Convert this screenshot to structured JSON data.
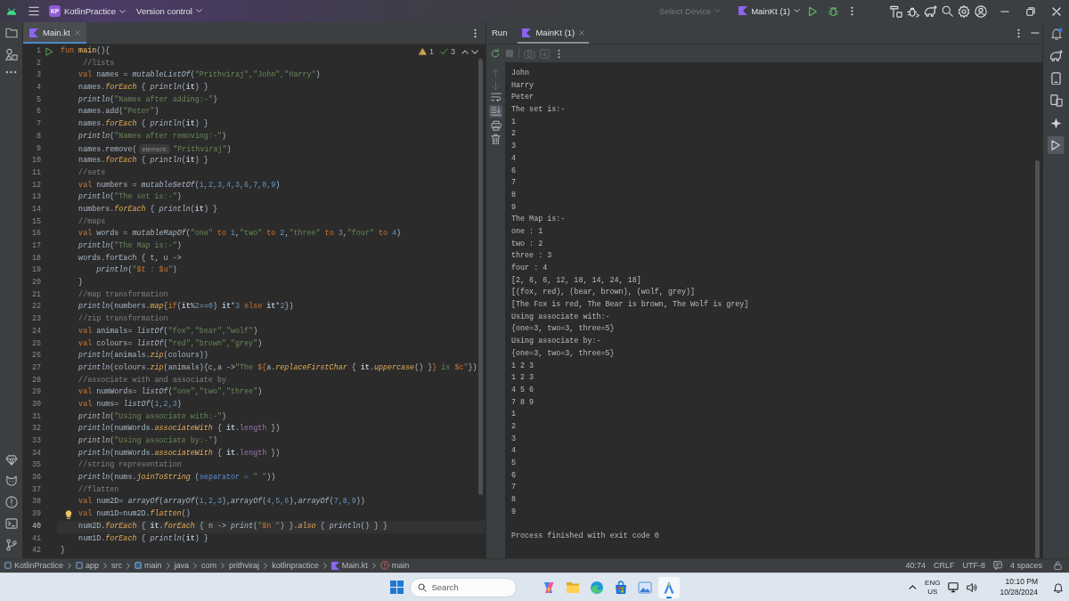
{
  "title_bar": {
    "project_badge": "KP",
    "project": "KotlinPractice",
    "vcs": "Version control",
    "device": {
      "label": "Select Device",
      "disabled": true
    },
    "run_config": "MainKt (1)"
  },
  "editor": {
    "tabs": [
      {
        "label": "Main.kt",
        "selected": true
      }
    ],
    "warnings": "1",
    "checks": "3",
    "lines": [
      {
        "number": "1",
        "kind": "run",
        "current": false,
        "tokens": [
          {
            "kind": "kw",
            "text": "fun "
          },
          {
            "kind": "decl",
            "text": "main"
          },
          {
            "kind": "txt",
            "text": "(){"
          }
        ]
      },
      {
        "number": "2",
        "kind": "plain",
        "current": false,
        "tokens": [
          {
            "kind": "cmt",
            "text": "     //lists"
          }
        ]
      },
      {
        "number": "3",
        "kind": "plain",
        "current": false,
        "tokens": [
          {
            "kind": "kw",
            "text": "    val "
          },
          {
            "kind": "txt",
            "text": "names = "
          },
          {
            "kind": "call",
            "text": "mutableListOf"
          },
          {
            "kind": "txt",
            "text": "("
          },
          {
            "kind": "str",
            "text": "\"Prithviraj\",\"John\",\"Harry\""
          },
          {
            "kind": "txt",
            "text": ")"
          }
        ]
      },
      {
        "number": "4",
        "kind": "plain",
        "current": false,
        "tokens": [
          {
            "kind": "txt",
            "text": "    names."
          },
          {
            "kind": "ext",
            "text": "forEach"
          },
          {
            "kind": "txt",
            "text": " { "
          },
          {
            "kind": "call",
            "text": "println"
          },
          {
            "kind": "txt",
            "text": "("
          },
          {
            "kind": "it",
            "text": "it"
          },
          {
            "kind": "txt",
            "text": ") }"
          }
        ]
      },
      {
        "number": "5",
        "kind": "plain",
        "current": false,
        "tokens": [
          {
            "kind": "call",
            "text": "    println"
          },
          {
            "kind": "txt",
            "text": "("
          },
          {
            "kind": "str",
            "text": "\"Names after adding:-\""
          },
          {
            "kind": "txt",
            "text": ")"
          }
        ]
      },
      {
        "number": "6",
        "kind": "plain",
        "current": false,
        "tokens": [
          {
            "kind": "txt",
            "text": "    names.add("
          },
          {
            "kind": "str",
            "text": "\"Peter\""
          },
          {
            "kind": "txt",
            "text": ")"
          }
        ]
      },
      {
        "number": "7",
        "kind": "plain",
        "current": false,
        "tokens": [
          {
            "kind": "txt",
            "text": "    names."
          },
          {
            "kind": "ext",
            "text": "forEach"
          },
          {
            "kind": "txt",
            "text": " { "
          },
          {
            "kind": "call",
            "text": "println"
          },
          {
            "kind": "txt",
            "text": "("
          },
          {
            "kind": "it",
            "text": "it"
          },
          {
            "kind": "txt",
            "text": ") }"
          }
        ]
      },
      {
        "number": "8",
        "kind": "plain",
        "current": false,
        "tokens": [
          {
            "kind": "call",
            "text": "    println"
          },
          {
            "kind": "txt",
            "text": "("
          },
          {
            "kind": "str",
            "text": "\"Names after removing:-\""
          },
          {
            "kind": "txt",
            "text": ")"
          }
        ]
      },
      {
        "number": "9",
        "kind": "plain",
        "current": false,
        "tokens": [
          {
            "kind": "txt",
            "text": "    names.remove("
          },
          {
            "kind": "hint",
            "text": "element:"
          },
          {
            "kind": "str",
            "text": "\"Prithviraj\""
          },
          {
            "kind": "txt",
            "text": ")"
          }
        ]
      },
      {
        "number": "10",
        "kind": "plain",
        "current": false,
        "tokens": [
          {
            "kind": "txt",
            "text": "    names."
          },
          {
            "kind": "ext",
            "text": "forEach"
          },
          {
            "kind": "txt",
            "text": " { "
          },
          {
            "kind": "call",
            "text": "println"
          },
          {
            "kind": "txt",
            "text": "("
          },
          {
            "kind": "it",
            "text": "it"
          },
          {
            "kind": "txt",
            "text": ") }"
          }
        ]
      },
      {
        "number": "11",
        "kind": "plain",
        "current": false,
        "tokens": [
          {
            "kind": "cmt",
            "text": "    //sets"
          }
        ]
      },
      {
        "number": "12",
        "kind": "plain",
        "current": false,
        "tokens": [
          {
            "kind": "kw",
            "text": "    val "
          },
          {
            "kind": "txt",
            "text": "numbers = "
          },
          {
            "kind": "call",
            "text": "mutableSetOf"
          },
          {
            "kind": "txt",
            "text": "("
          },
          {
            "kind": "num",
            "text": "1,2,3,4,3,6,7,8,9"
          },
          {
            "kind": "txt",
            "text": ")"
          }
        ]
      },
      {
        "number": "13",
        "kind": "plain",
        "current": false,
        "tokens": [
          {
            "kind": "call",
            "text": "    println"
          },
          {
            "kind": "txt",
            "text": "("
          },
          {
            "kind": "str",
            "text": "\"The set is:-\""
          },
          {
            "kind": "txt",
            "text": ")"
          }
        ]
      },
      {
        "number": "14",
        "kind": "plain",
        "current": false,
        "tokens": [
          {
            "kind": "txt",
            "text": "    numbers."
          },
          {
            "kind": "ext",
            "text": "forEach"
          },
          {
            "kind": "txt",
            "text": " { "
          },
          {
            "kind": "call",
            "text": "println"
          },
          {
            "kind": "txt",
            "text": "("
          },
          {
            "kind": "it",
            "text": "it"
          },
          {
            "kind": "txt",
            "text": ") }"
          }
        ]
      },
      {
        "number": "15",
        "kind": "plain",
        "current": false,
        "tokens": [
          {
            "kind": "cmt",
            "text": "    //maps"
          }
        ]
      },
      {
        "number": "16",
        "kind": "plain",
        "current": false,
        "tokens": [
          {
            "kind": "kw",
            "text": "    val "
          },
          {
            "kind": "txt",
            "text": "words = "
          },
          {
            "kind": "call",
            "text": "mutableMapOf"
          },
          {
            "kind": "txt",
            "text": "("
          },
          {
            "kind": "str",
            "text": "\"one\""
          },
          {
            "kind": "kw",
            "text": " to "
          },
          {
            "kind": "num",
            "text": "1"
          },
          {
            "kind": "txt",
            "text": ","
          },
          {
            "kind": "str",
            "text": "\"two\""
          },
          {
            "kind": "kw",
            "text": " to "
          },
          {
            "kind": "num",
            "text": "2"
          },
          {
            "kind": "txt",
            "text": ","
          },
          {
            "kind": "str",
            "text": "\"three\""
          },
          {
            "kind": "kw",
            "text": " to "
          },
          {
            "kind": "num",
            "text": "3"
          },
          {
            "kind": "txt",
            "text": ","
          },
          {
            "kind": "str",
            "text": "\"four\""
          },
          {
            "kind": "kw",
            "text": " to "
          },
          {
            "kind": "num",
            "text": "4"
          },
          {
            "kind": "txt",
            "text": ")"
          }
        ]
      },
      {
        "number": "17",
        "kind": "plain",
        "current": false,
        "tokens": [
          {
            "kind": "call",
            "text": "    println"
          },
          {
            "kind": "txt",
            "text": "("
          },
          {
            "kind": "str",
            "text": "\"The Map is:-\""
          },
          {
            "kind": "txt",
            "text": ")"
          }
        ]
      },
      {
        "number": "18",
        "kind": "plain",
        "current": false,
        "tokens": [
          {
            "kind": "txt",
            "text": "    words.forEach { t, u ->"
          }
        ]
      },
      {
        "number": "19",
        "kind": "plain",
        "current": false,
        "tokens": [
          {
            "kind": "call",
            "text": "        println"
          },
          {
            "kind": "txt",
            "text": "("
          },
          {
            "kind": "str",
            "text": "\""
          },
          {
            "kind": "kw",
            "text": "$t"
          },
          {
            "kind": "str",
            "text": " : "
          },
          {
            "kind": "kw",
            "text": "$u"
          },
          {
            "kind": "str",
            "text": "\""
          },
          {
            "kind": "txt",
            "text": ")"
          }
        ]
      },
      {
        "number": "20",
        "kind": "plain",
        "current": false,
        "tokens": [
          {
            "kind": "txt",
            "text": "    }"
          }
        ]
      },
      {
        "number": "21",
        "kind": "plain",
        "current": false,
        "tokens": [
          {
            "kind": "cmt",
            "text": "    //map transformation"
          }
        ]
      },
      {
        "number": "22",
        "kind": "plain",
        "current": false,
        "tokens": [
          {
            "kind": "call",
            "text": "    println"
          },
          {
            "kind": "txt",
            "text": "(numbers."
          },
          {
            "kind": "ext",
            "text": "map"
          },
          {
            "kind": "txt",
            "text": "{"
          },
          {
            "kind": "kw",
            "text": "if"
          },
          {
            "kind": "txt",
            "text": "("
          },
          {
            "kind": "it",
            "text": "it"
          },
          {
            "kind": "txt",
            "text": "%"
          },
          {
            "kind": "num",
            "text": "2"
          },
          {
            "kind": "txt",
            "text": "=="
          },
          {
            "kind": "num",
            "text": "0"
          },
          {
            "kind": "txt",
            "text": ") "
          },
          {
            "kind": "it",
            "text": "it"
          },
          {
            "kind": "txt",
            "text": "*"
          },
          {
            "kind": "num",
            "text": "3"
          },
          {
            "kind": "kw",
            "text": " else "
          },
          {
            "kind": "it",
            "text": "it"
          },
          {
            "kind": "txt",
            "text": "*"
          },
          {
            "kind": "num",
            "text": "2"
          },
          {
            "kind": "txt",
            "text": "})"
          }
        ]
      },
      {
        "number": "23",
        "kind": "plain",
        "current": false,
        "tokens": [
          {
            "kind": "cmt",
            "text": "    //zip transformation"
          }
        ]
      },
      {
        "number": "24",
        "kind": "plain",
        "current": false,
        "tokens": [
          {
            "kind": "kw",
            "text": "    val "
          },
          {
            "kind": "txt",
            "text": "animals= "
          },
          {
            "kind": "call",
            "text": "listOf"
          },
          {
            "kind": "txt",
            "text": "("
          },
          {
            "kind": "str",
            "text": "\"fox\",\"bear\",\"wolf\""
          },
          {
            "kind": "txt",
            "text": ")"
          }
        ]
      },
      {
        "number": "25",
        "kind": "plain",
        "current": false,
        "tokens": [
          {
            "kind": "kw",
            "text": "    val "
          },
          {
            "kind": "txt",
            "text": "colours= "
          },
          {
            "kind": "call",
            "text": "listOf"
          },
          {
            "kind": "txt",
            "text": "("
          },
          {
            "kind": "str",
            "text": "\"red\",\"brown\",\"grey\""
          },
          {
            "kind": "txt",
            "text": ")"
          }
        ]
      },
      {
        "number": "26",
        "kind": "plain",
        "current": false,
        "tokens": [
          {
            "kind": "call",
            "text": "    println"
          },
          {
            "kind": "txt",
            "text": "(animals."
          },
          {
            "kind": "ext",
            "text": "zip"
          },
          {
            "kind": "txt",
            "text": "(colours))"
          }
        ]
      },
      {
        "number": "27",
        "kind": "plain",
        "current": false,
        "tokens": [
          {
            "kind": "call",
            "text": "    println"
          },
          {
            "kind": "txt",
            "text": "(colours."
          },
          {
            "kind": "ext",
            "text": "zip"
          },
          {
            "kind": "txt",
            "text": "(animals){c,a ->"
          },
          {
            "kind": "str",
            "text": "\"The "
          },
          {
            "kind": "kw",
            "text": "${"
          },
          {
            "kind": "txt",
            "text": "a."
          },
          {
            "kind": "ext",
            "text": "replaceFirstChar"
          },
          {
            "kind": "txt",
            "text": " { "
          },
          {
            "kind": "it",
            "text": "it"
          },
          {
            "kind": "txt",
            "text": "."
          },
          {
            "kind": "ext",
            "text": "uppercase"
          },
          {
            "kind": "txt",
            "text": "() }"
          },
          {
            "kind": "kw",
            "text": "}"
          },
          {
            "kind": "str",
            "text": " is "
          },
          {
            "kind": "kw",
            "text": "$c"
          },
          {
            "kind": "str",
            "text": "\""
          },
          {
            "kind": "txt",
            "text": "})"
          }
        ]
      },
      {
        "number": "28",
        "kind": "plain",
        "current": false,
        "tokens": [
          {
            "kind": "cmt",
            "text": "    //associate with and associate by"
          }
        ]
      },
      {
        "number": "29",
        "kind": "plain",
        "current": false,
        "tokens": [
          {
            "kind": "kw",
            "text": "    val "
          },
          {
            "kind": "txt",
            "text": "numWords= "
          },
          {
            "kind": "call",
            "text": "listOf"
          },
          {
            "kind": "txt",
            "text": "("
          },
          {
            "kind": "str",
            "text": "\"one\",\"two\",\"three\""
          },
          {
            "kind": "txt",
            "text": ")"
          }
        ]
      },
      {
        "number": "30",
        "kind": "plain",
        "current": false,
        "tokens": [
          {
            "kind": "kw",
            "text": "    val "
          },
          {
            "kind": "txt",
            "text": "nums= "
          },
          {
            "kind": "call",
            "text": "listOf"
          },
          {
            "kind": "txt",
            "text": "("
          },
          {
            "kind": "num",
            "text": "1,2,3"
          },
          {
            "kind": "txt",
            "text": ")"
          }
        ]
      },
      {
        "number": "31",
        "kind": "plain",
        "current": false,
        "tokens": [
          {
            "kind": "call",
            "text": "    println"
          },
          {
            "kind": "txt",
            "text": "("
          },
          {
            "kind": "str",
            "text": "\"Using associate with:-\""
          },
          {
            "kind": "txt",
            "text": ")"
          }
        ]
      },
      {
        "number": "32",
        "kind": "plain",
        "current": false,
        "tokens": [
          {
            "kind": "call",
            "text": "    println"
          },
          {
            "kind": "txt",
            "text": "(numWords."
          },
          {
            "kind": "ext",
            "text": "associateWith"
          },
          {
            "kind": "txt",
            "text": " { "
          },
          {
            "kind": "it",
            "text": "it"
          },
          {
            "kind": "txt",
            "text": "."
          },
          {
            "kind": "prop",
            "text": "length"
          },
          {
            "kind": "txt",
            "text": " })"
          }
        ]
      },
      {
        "number": "33",
        "kind": "plain",
        "current": false,
        "tokens": [
          {
            "kind": "call",
            "text": "    println"
          },
          {
            "kind": "txt",
            "text": "("
          },
          {
            "kind": "str",
            "text": "\"Using associate by:-\""
          },
          {
            "kind": "txt",
            "text": ")"
          }
        ]
      },
      {
        "number": "34",
        "kind": "plain",
        "current": false,
        "tokens": [
          {
            "kind": "call",
            "text": "    println"
          },
          {
            "kind": "txt",
            "text": "(numWords."
          },
          {
            "kind": "ext",
            "text": "associateWith"
          },
          {
            "kind": "txt",
            "text": " { "
          },
          {
            "kind": "it",
            "text": "it"
          },
          {
            "kind": "txt",
            "text": "."
          },
          {
            "kind": "prop",
            "text": "length"
          },
          {
            "kind": "txt",
            "text": " })"
          }
        ]
      },
      {
        "number": "35",
        "kind": "plain",
        "current": false,
        "tokens": [
          {
            "kind": "cmt",
            "text": "    //string representation"
          }
        ]
      },
      {
        "number": "36",
        "kind": "plain",
        "current": false,
        "tokens": [
          {
            "kind": "call",
            "text": "    println"
          },
          {
            "kind": "txt",
            "text": "(nums."
          },
          {
            "kind": "ext",
            "text": "joinToString"
          },
          {
            "kind": "txt",
            "text": " ("
          },
          {
            "kind": "arg",
            "text": "separator = "
          },
          {
            "kind": "str",
            "text": "\" \""
          },
          {
            "kind": "txt",
            "text": "))"
          }
        ]
      },
      {
        "number": "37",
        "kind": "plain",
        "current": false,
        "tokens": [
          {
            "kind": "cmt",
            "text": "    //flatten"
          }
        ]
      },
      {
        "number": "38",
        "kind": "plain",
        "current": false,
        "tokens": [
          {
            "kind": "kw",
            "text": "    val "
          },
          {
            "kind": "txt",
            "text": "num2D= "
          },
          {
            "kind": "call",
            "text": "arrayOf"
          },
          {
            "kind": "txt",
            "text": "("
          },
          {
            "kind": "call",
            "text": "arrayOf"
          },
          {
            "kind": "txt",
            "text": "("
          },
          {
            "kind": "num",
            "text": "1,2,3"
          },
          {
            "kind": "txt",
            "text": "),"
          },
          {
            "kind": "call",
            "text": "arrayOf"
          },
          {
            "kind": "txt",
            "text": "("
          },
          {
            "kind": "num",
            "text": "4,5,6"
          },
          {
            "kind": "txt",
            "text": "),"
          },
          {
            "kind": "call",
            "text": "arrayOf"
          },
          {
            "kind": "txt",
            "text": "("
          },
          {
            "kind": "num",
            "text": "7,8,9"
          },
          {
            "kind": "txt",
            "text": "))"
          }
        ]
      },
      {
        "number": "39",
        "kind": "bulb",
        "current": false,
        "tokens": [
          {
            "kind": "kw",
            "text": "    val "
          },
          {
            "kind": "txt",
            "text": "num1D=num2D."
          },
          {
            "kind": "ext",
            "text": "flatten"
          },
          {
            "kind": "txt",
            "text": "()"
          }
        ]
      },
      {
        "number": "40",
        "kind": "plain",
        "current": true,
        "tokens": [
          {
            "kind": "txt",
            "text": "    num2D."
          },
          {
            "kind": "ext",
            "text": "forEach"
          },
          {
            "kind": "txt",
            "text": " { "
          },
          {
            "kind": "it",
            "text": "it"
          },
          {
            "kind": "txt",
            "text": "."
          },
          {
            "kind": "ext",
            "text": "forEach"
          },
          {
            "kind": "txt",
            "text": " { n -> "
          },
          {
            "kind": "call",
            "text": "print"
          },
          {
            "kind": "txt",
            "text": "("
          },
          {
            "kind": "str",
            "text": "\""
          },
          {
            "kind": "kw",
            "text": "$n"
          },
          {
            "kind": "str",
            "text": " \""
          },
          {
            "kind": "txt",
            "text": ") }."
          },
          {
            "kind": "ext",
            "text": "also"
          },
          {
            "kind": "txt",
            "text": " { "
          },
          {
            "kind": "call",
            "text": "println"
          },
          {
            "kind": "txt",
            "text": "() } }"
          }
        ]
      },
      {
        "number": "41",
        "kind": "plain",
        "current": false,
        "tokens": [
          {
            "kind": "txt",
            "text": "    num1D."
          },
          {
            "kind": "ext",
            "text": "forEach"
          },
          {
            "kind": "txt",
            "text": " { "
          },
          {
            "kind": "call",
            "text": "println"
          },
          {
            "kind": "txt",
            "text": "("
          },
          {
            "kind": "it",
            "text": "it"
          },
          {
            "kind": "txt",
            "text": ") }"
          }
        ]
      },
      {
        "number": "42",
        "kind": "plain",
        "current": false,
        "tokens": [
          {
            "kind": "txt",
            "text": "}"
          }
        ]
      }
    ]
  },
  "run_panel": {
    "title": "Run",
    "tabs": [
      {
        "label": "MainKt (1)",
        "selected": true
      }
    ],
    "toolbar": [
      {
        "kind": "rerun",
        "disabled": false
      },
      {
        "kind": "stop",
        "disabled": true
      },
      {
        "kind": "camera",
        "disabled": true
      },
      {
        "kind": "export",
        "disabled": true
      }
    ],
    "side_tools": [
      {
        "kind": "up",
        "disabled": true,
        "on": false
      },
      {
        "kind": "down",
        "disabled": true,
        "on": false
      },
      {
        "kind": "wrap",
        "disabled": false,
        "on": false
      },
      {
        "kind": "scroll-end",
        "disabled": false,
        "on": true
      },
      {
        "kind": "print",
        "disabled": false,
        "on": false
      },
      {
        "kind": "trash",
        "disabled": false,
        "on": false
      }
    ],
    "output": [
      "John",
      "Harry",
      "Peter",
      "The set is:-",
      "1",
      "2",
      "3",
      "4",
      "6",
      "7",
      "8",
      "9",
      "The Map is:-",
      "one : 1",
      "two : 2",
      "three : 3",
      "four : 4",
      "[2, 6, 6, 12, 18, 14, 24, 18]",
      "[(fox, red), (bear, brown), (wolf, grey)]",
      "[The Fox is red, The Bear is brown, The Wolf is grey]",
      "Using associate with:-",
      "{one=3, two=3, three=5}",
      "Using associate by:-",
      "{one=3, two=3, three=5}",
      "1 2 3",
      "1 2 3",
      "4 5 6",
      "7 8 9",
      "1",
      "2",
      "3",
      "4",
      "5",
      "6",
      "7",
      "8",
      "9"
    ],
    "exit_message": "Process finished with exit code 0"
  },
  "right_strip": [
    {
      "kind": "elephant",
      "selected": false
    },
    {
      "kind": "phone",
      "selected": false
    },
    {
      "kind": "devices",
      "selected": false
    },
    {
      "kind": "sparkle",
      "selected": false
    },
    {
      "kind": "run",
      "selected": true
    }
  ],
  "status_bar": {
    "breadcrumbs": [
      {
        "kind": "module",
        "label": "KotlinPractice"
      },
      {
        "kind": "module",
        "label": "app"
      },
      {
        "kind": "dir",
        "label": "src"
      },
      {
        "kind": "source",
        "label": "main"
      },
      {
        "kind": "dir",
        "label": "java"
      },
      {
        "kind": "dir",
        "label": "com"
      },
      {
        "kind": "dir",
        "label": "prithviraj"
      },
      {
        "kind": "dir",
        "label": "kotlinpractice"
      },
      {
        "kind": "file",
        "label": "Main.kt"
      },
      {
        "kind": "function",
        "label": "main"
      }
    ],
    "position": "40:74",
    "line_separator": "CRLF",
    "encoding": "UTF-8",
    "indent": "4 spaces"
  },
  "taskbar": {
    "search": {
      "placeholder": "Search"
    },
    "apps": [
      {
        "kind": "copilot",
        "selected": false
      },
      {
        "kind": "explorer",
        "selected": false
      },
      {
        "kind": "browser",
        "selected": false
      },
      {
        "kind": "store",
        "selected": false
      },
      {
        "kind": "photos",
        "selected": false
      },
      {
        "kind": "studio",
        "selected": true
      }
    ],
    "language": "ENG",
    "region": "US",
    "time": "10:10 PM",
    "date": "10/28/2024"
  }
}
